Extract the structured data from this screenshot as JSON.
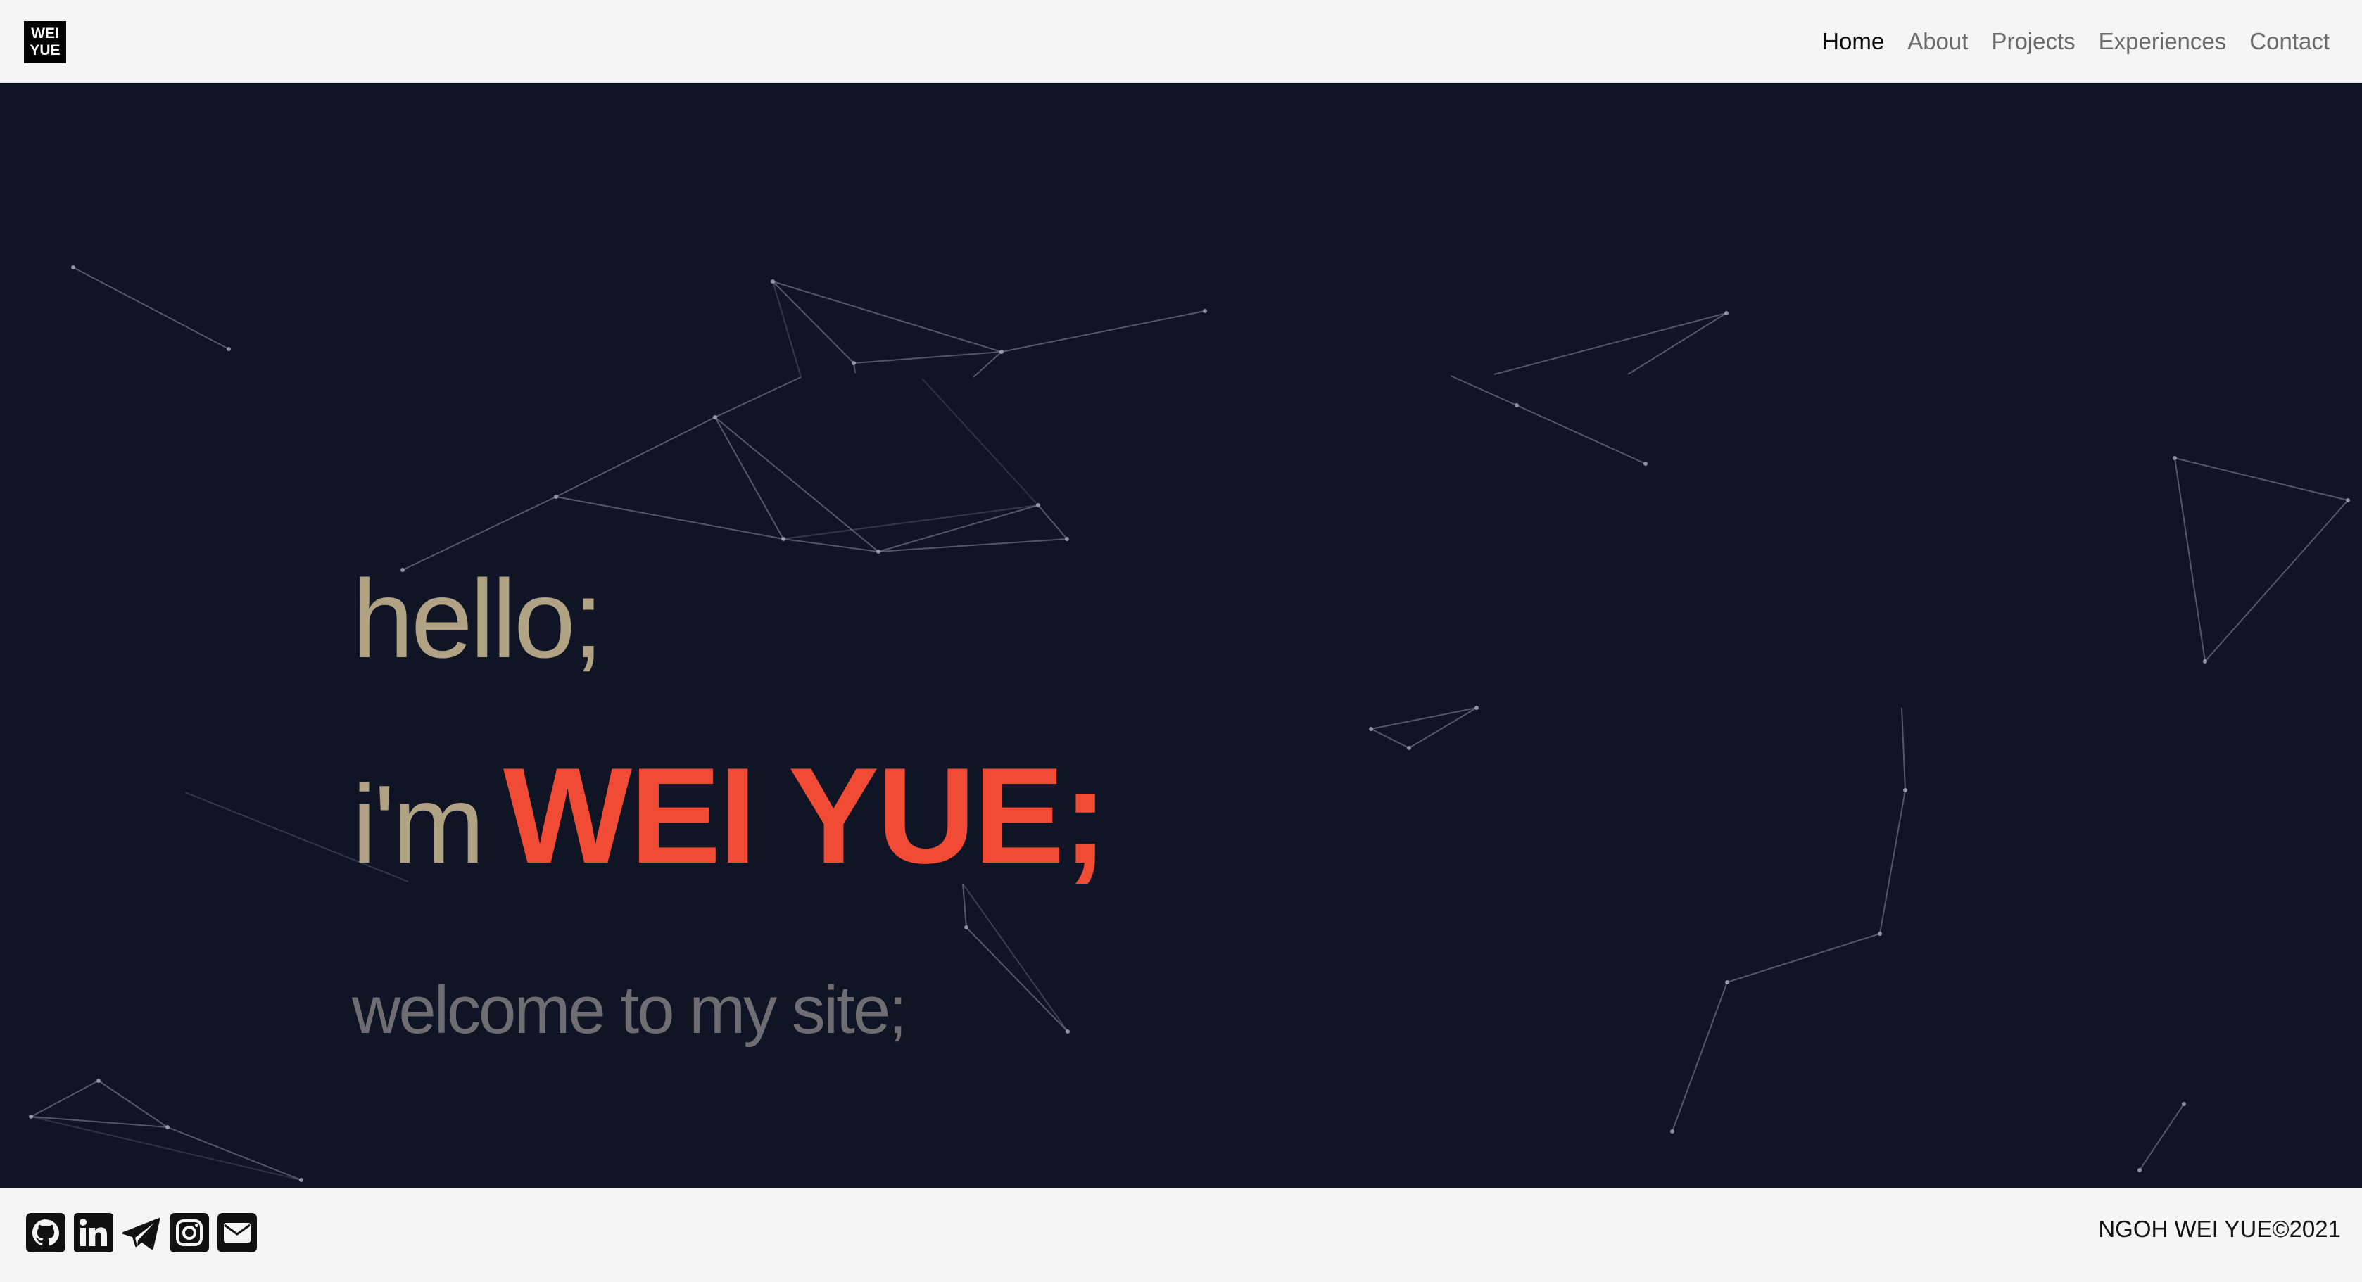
{
  "brand": {
    "logo_line1": "WEI",
    "logo_line2": "YUE"
  },
  "nav": {
    "items": [
      {
        "label": "Home",
        "active": true
      },
      {
        "label": "About",
        "active": false
      },
      {
        "label": "Projects",
        "active": false
      },
      {
        "label": "Experiences",
        "active": false
      },
      {
        "label": "Contact",
        "active": false
      }
    ]
  },
  "hero": {
    "greeting": "hello;",
    "intro_prefix": "i'm",
    "name": "WEI YUE;",
    "tagline": "welcome to my site;"
  },
  "footer": {
    "social_links": [
      {
        "icon": "github-icon",
        "label": "GitHub"
      },
      {
        "icon": "linkedin-icon",
        "label": "LinkedIn"
      },
      {
        "icon": "telegram-icon",
        "label": "Telegram"
      },
      {
        "icon": "instagram-icon",
        "label": "Instagram"
      },
      {
        "icon": "email-icon",
        "label": "Email"
      }
    ],
    "copyright": "NGOH WEI YUE©2021"
  },
  "colors": {
    "hero_background": "#0f1524",
    "navbar_background": "#f5f5f5",
    "accent_name": "#f14a35",
    "greeting_text": "#b1a283",
    "tagline_text": "#6d6d72",
    "network_lines": "#8a90a0"
  }
}
